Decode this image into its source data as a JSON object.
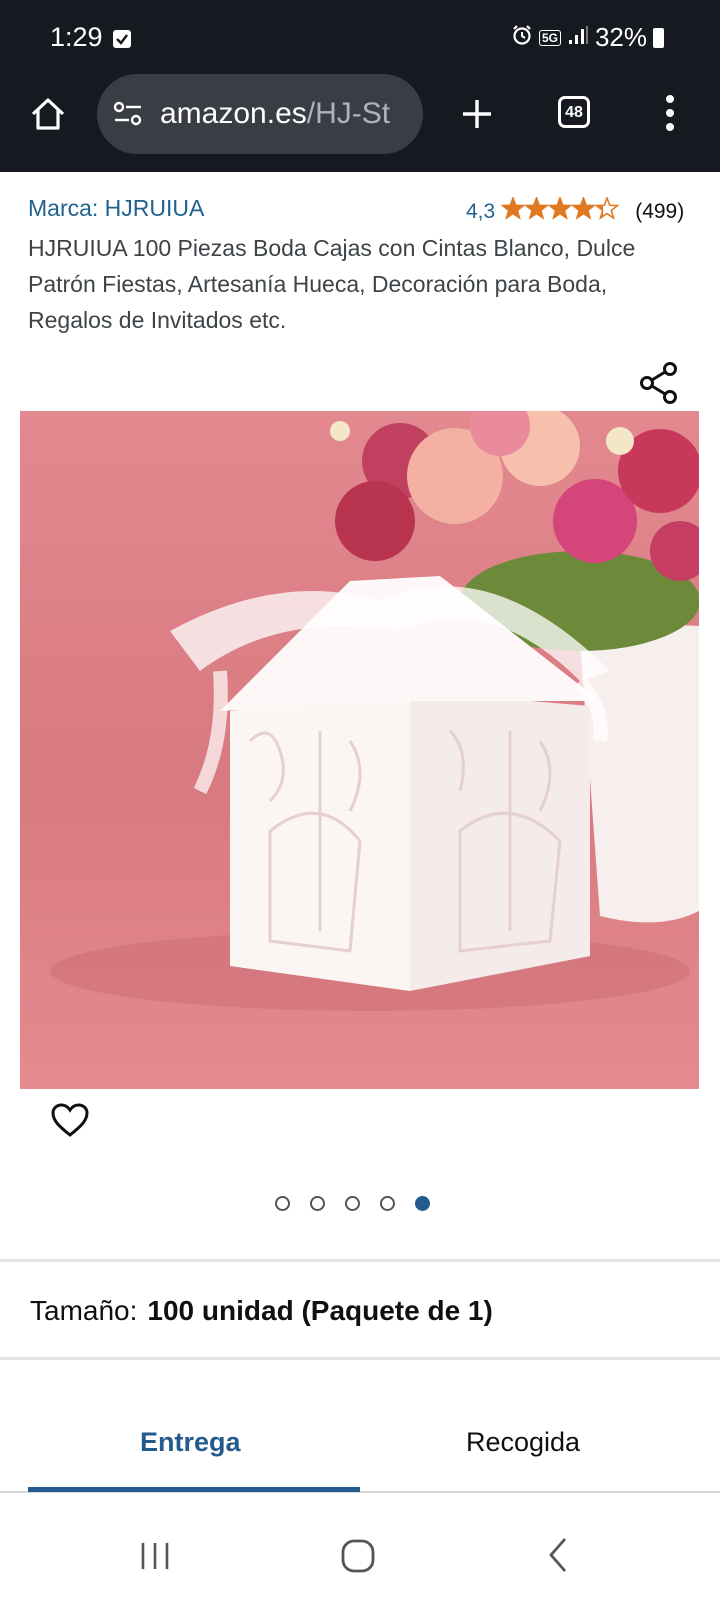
{
  "status_bar": {
    "time": "1:29",
    "network": "5G",
    "battery": "32%"
  },
  "browser": {
    "url_domain": "amazon.es",
    "url_path": "/HJ-St",
    "tab_count": "48"
  },
  "product": {
    "brand": "Marca: HJRUIUA",
    "rating_value": "4,3",
    "rating_stars": 4.3,
    "rating_count": "(499)",
    "title": "HJRUIUA 100 Piezas Boda Cajas con Cintas Blanco, Dulce Patrón Fiestas, Artesanía Hueca, Decoración para Boda, Regalos de Invitados etc.",
    "image_count": 5,
    "active_image": 5
  },
  "size": {
    "label": "Tamaño:",
    "value": "100 unidad (Paquete de 1)"
  },
  "delivery_tabs": [
    {
      "label": "Entrega",
      "active": true
    },
    {
      "label": "Recogida",
      "active": false
    }
  ],
  "colors": {
    "link": "#21628f",
    "accent": "#235b8c",
    "star": "#de7921",
    "topbar": "#16191f"
  }
}
